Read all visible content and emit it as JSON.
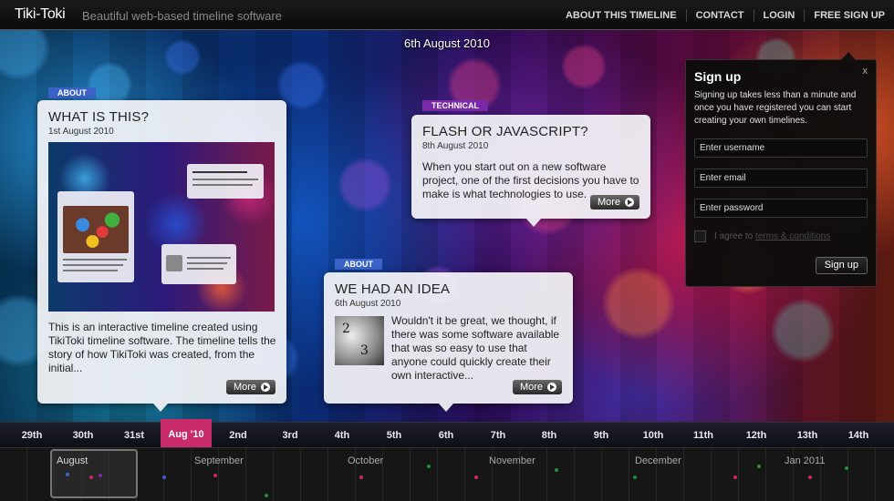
{
  "header": {
    "logo": "Tiki-Toki",
    "tagline": "Beautiful web-based timeline software",
    "nav": [
      "ABOUT THIS TIMELINE",
      "CONTACT",
      "LOGIN",
      "FREE SIGN UP"
    ]
  },
  "timeline": {
    "current_date": "6th August 2010"
  },
  "stories": [
    {
      "tag": "ABOUT",
      "title": "WHAT IS THIS?",
      "date": "1st August 2010",
      "text": "This is an interactive timeline created using TikiToki timeline software. The timeline tells the story of how TikiToki was created, from the initial...",
      "more": "More"
    },
    {
      "tag": "TECHNICAL",
      "title": "FLASH OR JAVASCRIPT?",
      "date": "8th August 2010",
      "text": "When you start out on a new software project, one of the first decisions you have to make is what technologies to use.",
      "more": "More"
    },
    {
      "tag": "ABOUT",
      "title": "WE HAD AN IDEA",
      "date": "6th August 2010",
      "text": "Wouldn't it be great, we thought, if there was some software available that was so easy to use that anyone could quickly create their own interactive...",
      "more": "More"
    }
  ],
  "signup": {
    "title": "Sign up",
    "close": "x",
    "intro": "Signing up takes less than a minute and once you have registered you can start creating your own timelines.",
    "username_placeholder": "Enter username",
    "email_placeholder": "Enter email",
    "password_placeholder": "Enter password",
    "agree_text": "I agree to",
    "terms_link": "terms & conditions",
    "submit": "Sign up"
  },
  "days": [
    "29th",
    "30th",
    "31st",
    "Aug '10",
    "2nd",
    "3rd",
    "4th",
    "5th",
    "6th",
    "7th",
    "8th",
    "9th",
    "10th",
    "11th",
    "12th",
    "13th",
    "14th"
  ],
  "active_day": "Aug '10",
  "months": [
    "August",
    "September",
    "October",
    "November",
    "December",
    "Jan 2011"
  ],
  "colors": {
    "about_tag": "#3a63c9",
    "technical_tag": "#7a2aa8",
    "active_day": "#c92a6a"
  }
}
